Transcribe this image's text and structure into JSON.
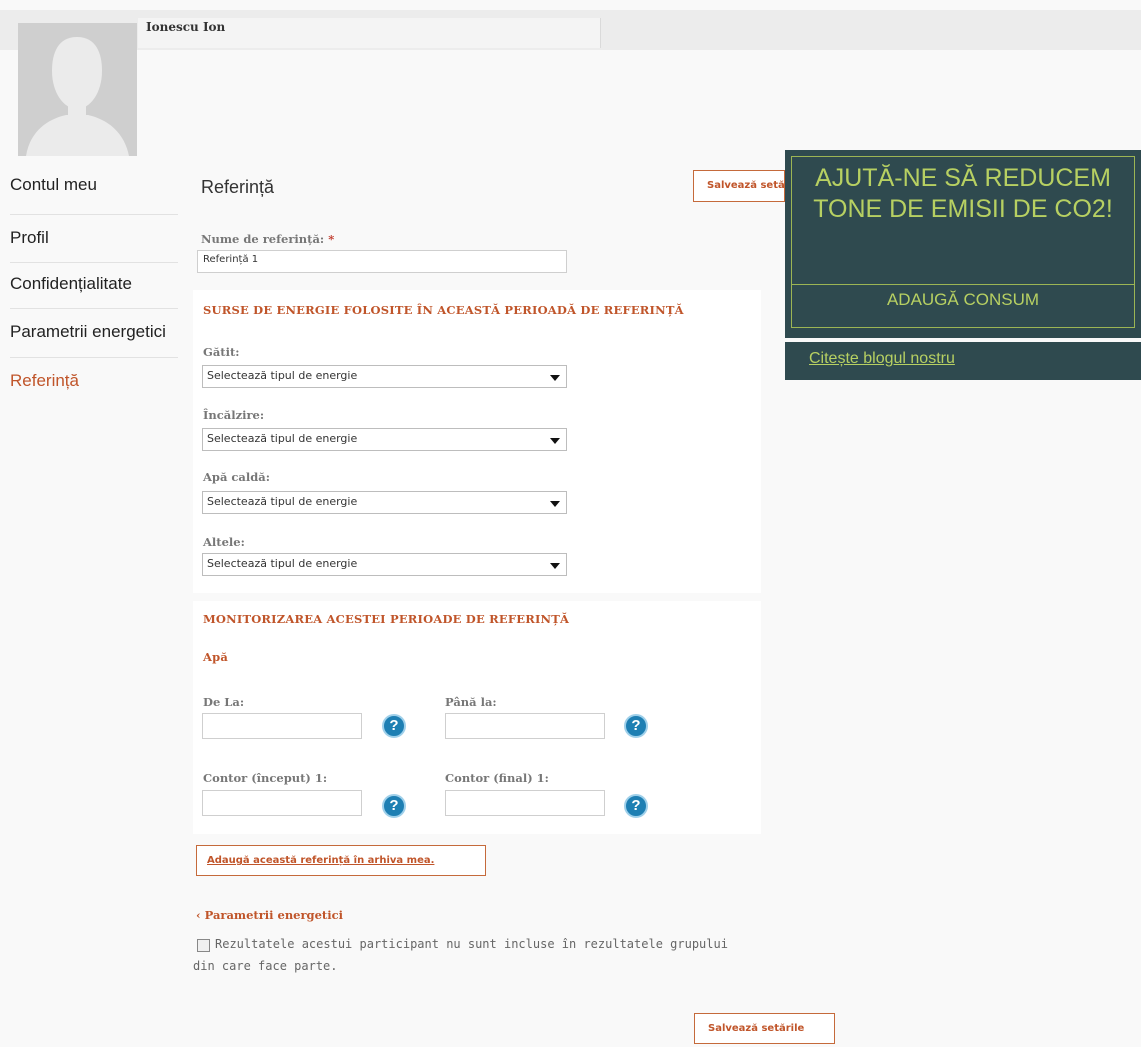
{
  "user": {
    "name": "Ionescu Ion"
  },
  "nav": {
    "items": [
      {
        "label": "Contul meu"
      },
      {
        "label": "Profil"
      },
      {
        "label": "Confidențialitate"
      },
      {
        "label": "Parametrii energetici"
      },
      {
        "label": "Referință"
      }
    ]
  },
  "page": {
    "title": "Referință",
    "save_label_top": "Salvează setările",
    "save_label_bottom": "Salvează setările"
  },
  "reference": {
    "name_label": "Nume de referință:",
    "required_mark": "*",
    "name_value": "Referință 1"
  },
  "energy": {
    "title": "SURSE DE ENERGIE FOLOSITE ÎN ACEASTĂ PERIOADĂ DE REFERINȚĂ",
    "fields": [
      {
        "label": "Gătit:",
        "value": "Selectează tipul de energie"
      },
      {
        "label": "Încălzire:",
        "value": "Selectează tipul de energie"
      },
      {
        "label": "Apă caldă:",
        "value": "Selectează tipul de energie"
      },
      {
        "label": "Altele:",
        "value": "Selectează tipul de energie"
      }
    ]
  },
  "monitoring": {
    "title": "MONITORIZAREA ACESTEI PERIOADE DE REFERINȚĂ",
    "subtitle": "Apă",
    "from_label": "De La:",
    "to_label": "Până la:",
    "counter_start_label": "Contor (început) 1:",
    "counter_end_label": "Contor (final) 1:",
    "help_glyph": "?"
  },
  "archive_button": "Adaugă această referință în arhiva mea.",
  "back_link": "‹ Parametrii energetici",
  "exclude_note": "Rezultatele acestui participant nu sunt incluse în rezultatele grupului din care face parte.",
  "promo": {
    "headline": "AJUTĂ-NE SĂ REDUCEM TONE DE EMISII DE CO2!",
    "cta": "ADAUGĂ CONSUM",
    "blog_link": "Citește blogul nostru"
  },
  "colors": {
    "accent": "#c0552a",
    "promo_bg": "#2f4a4f",
    "promo_text": "#b7d062",
    "help_icon": "#1e7fb3"
  },
  "icons": {
    "avatar": "avatar-silhouette",
    "help": "help-question-icon",
    "dropdown": "chevron-down-icon",
    "checkbox": "checkbox-icon"
  }
}
